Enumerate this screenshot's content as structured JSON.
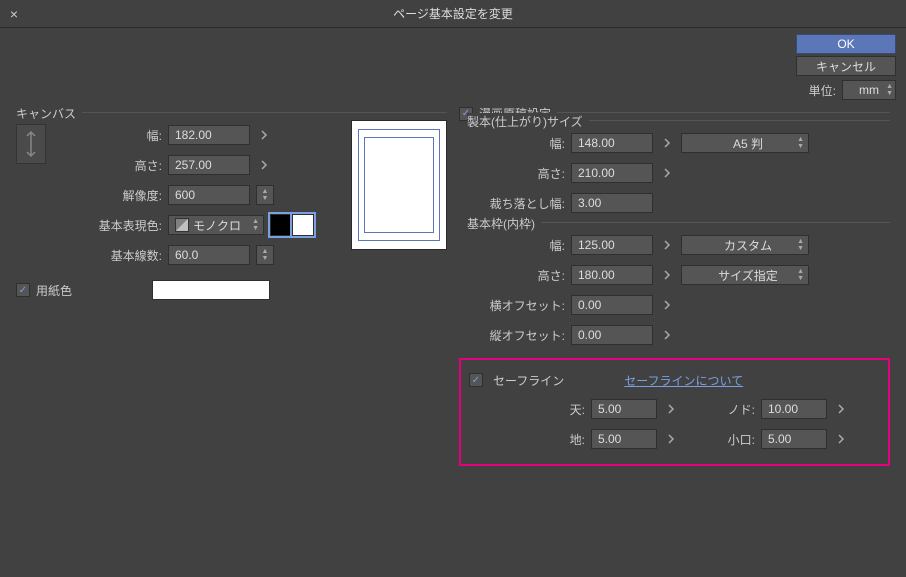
{
  "dialog": {
    "title": "ページ基本設定を変更",
    "ok": "OK",
    "cancel": "キャンセル",
    "unit_label": "単位:",
    "unit_value": "mm"
  },
  "canvas": {
    "legend": "キャンバス",
    "width_label": "幅:",
    "width": "182.00",
    "height_label": "高さ:",
    "height": "257.00",
    "resolution_label": "解像度:",
    "resolution": "600",
    "display_color_label": "基本表現色:",
    "display_color": "モノクロ",
    "lines_label": "基本線数:",
    "lines": "60.0",
    "paper_color_enabled": true,
    "paper_color_label": "用紙色",
    "paper_color": "#ffffff",
    "swatch1": "#000000",
    "swatch2": "#ffffff"
  },
  "manga": {
    "enabled": true,
    "legend": "漫画原稿設定",
    "binding": {
      "legend": "製本(仕上がり)サイズ",
      "width_label": "幅:",
      "width": "148.00",
      "height_label": "高さ:",
      "height": "210.00",
      "bleed_label": "裁ち落とし幅:",
      "bleed": "3.00",
      "preset": "A5 判"
    },
    "frame": {
      "legend": "基本枠(内枠)",
      "width_label": "幅:",
      "width": "125.00",
      "height_label": "高さ:",
      "height": "180.00",
      "hoffset_label": "横オフセット:",
      "hoffset": "0.00",
      "voffset_label": "縦オフセット:",
      "voffset": "0.00",
      "preset1": "カスタム",
      "preset2": "サイズ指定"
    },
    "safe": {
      "enabled": true,
      "legend": "セーフライン",
      "about": "セーフラインについて",
      "top_label": "天:",
      "top": "5.00",
      "bottom_label": "地:",
      "bottom": "5.00",
      "spine_label": "ノド:",
      "spine": "10.00",
      "edge_label": "小口:",
      "edge": "5.00"
    }
  }
}
